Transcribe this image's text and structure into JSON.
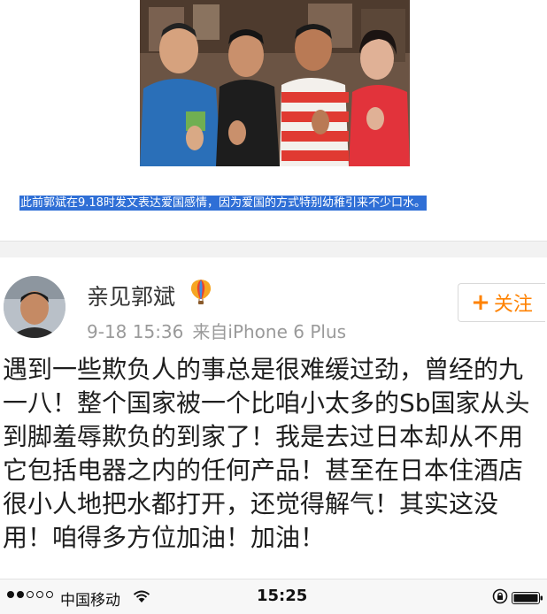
{
  "caption": "此前郭斌在9.18时发文表达爱国感情，因为爱国的方式特别幼稚引来不少口水。",
  "post": {
    "username": "亲见郭斌",
    "timestamp": "9-18 15:36",
    "source": "来自iPhone 6 Plus",
    "follow_label": "关注",
    "text": "遇到一些欺负人的事总是很难缓过劲，曾经的九一八！整个国家被一个比咱小太多的Sb国家从头到脚羞辱欺负的到家了！我是去过日本却从不用它包括电器之内的任何产品！甚至在日本住酒店很小人地把水都打开，还觉得解气！其实这没用！咱得多方位加油！加油！"
  },
  "status_bar": {
    "carrier": "中国移动",
    "time": "15:25"
  },
  "colors": {
    "follow_orange": "#ff8200",
    "caption_highlight": "#2f6fd6"
  },
  "icons": {
    "badge": "hot-air-balloon-icon",
    "wifi": "wifi-icon",
    "lock": "rotation-lock-icon",
    "battery": "battery-icon"
  }
}
